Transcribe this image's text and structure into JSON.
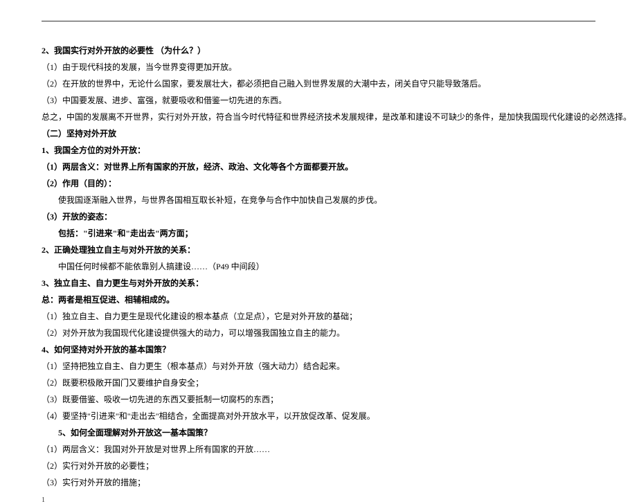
{
  "lines": [
    {
      "text": "2、我国实行对外开放的必要性 （为什么？）",
      "bold": true,
      "indent": false
    },
    {
      "text": "（1）由于现代科技的发展，当今世界变得更加开放。",
      "bold": false,
      "indent": false
    },
    {
      "text": "（2）在开放的世界中，无论什么国家，要发展壮大，都必须把自己融入到世界发展的大潮中去，闭关自守只能导致落后。",
      "bold": false,
      "indent": false
    },
    {
      "text": "（3）中国要发展、进步、富强，就要吸收和借鉴一切先进的东西。",
      "bold": false,
      "indent": false
    },
    {
      "text": "总之，中国的发展离不开世界，实行对外开放，符合当今时代特征和世界经济技术发展规律，是改革和建设不可缺少的条件，是加快我国现代化建设的必然选择。",
      "bold": false,
      "indent": false
    },
    {
      "text": "（二）坚持对外开放",
      "bold": true,
      "indent": false
    },
    {
      "text": "1、我国全方位的对外开放：",
      "bold": true,
      "indent": false
    },
    {
      "text": "（1）两层含义：对世界上所有国家的开放，经济、政治、文化等各个方面都要开放。",
      "bold": true,
      "indent": false
    },
    {
      "text": "（2）作用（目的）：",
      "bold": true,
      "indent": false
    },
    {
      "text": "使我国逐渐融入世界，与世界各国相互取长补短，在竞争与合作中加快自己发展的步伐。",
      "bold": false,
      "indent": true
    },
    {
      "text": "（3）开放的姿态：",
      "bold": true,
      "indent": false
    },
    {
      "text": "包括：\"引进来\"和\"走出去\"两方面；",
      "bold": true,
      "indent": true
    },
    {
      "text": "2、正确处理独立自主与对外开放的关系：",
      "bold": true,
      "indent": false
    },
    {
      "text": "中国任何时候都不能依靠别人搞建设……（P49 中间段）",
      "bold": false,
      "indent": true
    },
    {
      "text": "3、独立自主、自力更生与对外开放的关系：",
      "bold": true,
      "indent": false
    },
    {
      "text": "总：两者是相互促进、相辅相成的。",
      "bold": true,
      "indent": false
    },
    {
      "text": "（1）独立自主、自力更生是现代化建设的根本基点（立足点），它是对外开放的基础；",
      "bold": false,
      "indent": false
    },
    {
      "text": "（2）对外开放为我国现代化建设提供强大的动力，可以增强我国独立自主的能力。",
      "bold": false,
      "indent": false
    },
    {
      "text": "4、如何坚持对外开放的基本国策？",
      "bold": true,
      "indent": false
    },
    {
      "text": "（1）坚持把独立自主、自力更生（根本基点）与对外开放（强大动力）结合起来。",
      "bold": false,
      "indent": false
    },
    {
      "text": "（2）既要积极敞开国门又要维护自身安全；",
      "bold": false,
      "indent": false
    },
    {
      "text": "（3）既要借鉴、吸收一切先进的东西又要抵制一切腐朽的东西；",
      "bold": false,
      "indent": false
    },
    {
      "text": "（4）要坚持\"引进来\"和\"走出去\"相结合，全面提高对外开放水平，以开放促改革、促发展。",
      "bold": false,
      "indent": false
    },
    {
      "text": "5、如何全面理解对外开放这一基本国策？",
      "bold": true,
      "indent": true
    },
    {
      "text": "（1）两层含义：我国对外开放是对世界上所有国家的开放……",
      "bold": false,
      "indent": false
    },
    {
      "text": "（2）实行对外开放的必要性；",
      "bold": false,
      "indent": false
    },
    {
      "text": "（3）实行对外开放的措施；",
      "bold": false,
      "indent": false
    }
  ],
  "footer": "1"
}
